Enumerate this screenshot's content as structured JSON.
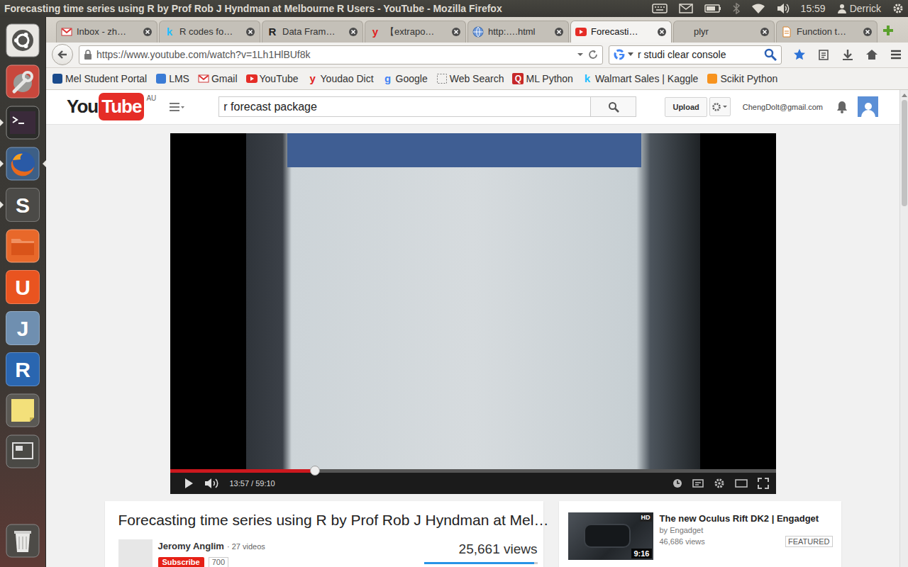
{
  "window": {
    "title": "Forecasting time series using R by Prof Rob J Hyndman at Melbourne R Users - YouTube - Mozilla Firefox"
  },
  "panel": {
    "time": "15:59",
    "user": "Derrick"
  },
  "launcher": [
    {
      "kind": "dash",
      "running": false,
      "focused": false
    },
    {
      "kind": "settings",
      "running": false,
      "focused": false
    },
    {
      "kind": "terminal",
      "running": true,
      "focused": false
    },
    {
      "kind": "firefox",
      "running": true,
      "focused": true
    },
    {
      "kind": "letter",
      "glyph": "S",
      "color": "#4b4a47",
      "running": true,
      "focused": false
    },
    {
      "kind": "files",
      "running": false,
      "focused": false
    },
    {
      "kind": "letter",
      "glyph": "U",
      "color": "#e95420",
      "running": false,
      "focused": false
    },
    {
      "kind": "letter",
      "glyph": "J",
      "color": "#6f8fb0",
      "running": false,
      "focused": false
    },
    {
      "kind": "letter",
      "glyph": "R",
      "color": "#2a66b0",
      "running": false,
      "focused": false
    },
    {
      "kind": "notes",
      "running": false,
      "focused": false
    },
    {
      "kind": "workspace",
      "running": false,
      "focused": false
    },
    {
      "kind": "trash",
      "running": false,
      "focused": false
    }
  ],
  "tabs": [
    {
      "label": "Inbox - zh…",
      "selected": false,
      "kind": "gmail"
    },
    {
      "label": "R codes fo…",
      "selected": false,
      "kind": "letter",
      "glyph": "k",
      "color": "#20beff"
    },
    {
      "label": "Data Fram…",
      "selected": false,
      "kind": "letter",
      "glyph": "R",
      "color": "#222222"
    },
    {
      "label": "【extrapo…",
      "selected": false,
      "kind": "letter",
      "glyph": "y",
      "color": "#e02020"
    },
    {
      "label": "http:….html",
      "selected": false,
      "kind": "globe"
    },
    {
      "label": "Forecasti…",
      "selected": true,
      "kind": "youtube"
    },
    {
      "label": "plyr",
      "selected": false,
      "kind": "none"
    },
    {
      "label": "Function t…",
      "selected": false,
      "kind": "page"
    }
  ],
  "nav": {
    "url": "https://www.youtube.com/watch?v=1Lh1HlBUf8k",
    "search": "r studi clear console"
  },
  "bookmarks": [
    {
      "label": "Mel Student Portal",
      "kind": "shape",
      "color": "#1a4b8c"
    },
    {
      "label": "LMS",
      "kind": "shape",
      "color": "#3a7bd5"
    },
    {
      "label": "Gmail",
      "kind": "gmail"
    },
    {
      "label": "YouTube",
      "kind": "youtube"
    },
    {
      "label": "Youdao Dict",
      "kind": "letter",
      "glyph": "y",
      "color": "#e02020"
    },
    {
      "label": "Google",
      "kind": "letter",
      "glyph": "g",
      "color": "#4285f4"
    },
    {
      "label": "Web Search",
      "kind": "dotted"
    },
    {
      "label": "ML Python",
      "kind": "boxletter",
      "glyph": "Q",
      "color": "#c62828"
    },
    {
      "label": "Walmart Sales | Kaggle",
      "kind": "letter",
      "glyph": "k",
      "color": "#20beff"
    },
    {
      "label": "Scikit Python",
      "kind": "shape",
      "color": "#f7931e"
    }
  ],
  "youtube": {
    "logo_you": "You",
    "logo_tube": "Tube",
    "region": "AU",
    "search": "r forecast package",
    "upload": "Upload",
    "account": "ChengDolt@gmail.com"
  },
  "player": {
    "time": "13:57 / 59:10",
    "level": 0.24,
    "playing": false
  },
  "video_info": {
    "title": "Forecasting time series using R by Prof Rob J Hyndman at Mel…",
    "channel": "Jeromy Anglim",
    "videos": "· 27 videos",
    "views": "25,661 views",
    "rating_level": 0.97,
    "subscribe": "Subscribe",
    "subscribers": "700"
  },
  "suggestion": {
    "title": "The new Oculus Rift DK2 | Engadget",
    "by": "by Engadget",
    "views": "46,686 views",
    "badge": "FEATURED",
    "quality": "HD",
    "duration": "9:16"
  }
}
